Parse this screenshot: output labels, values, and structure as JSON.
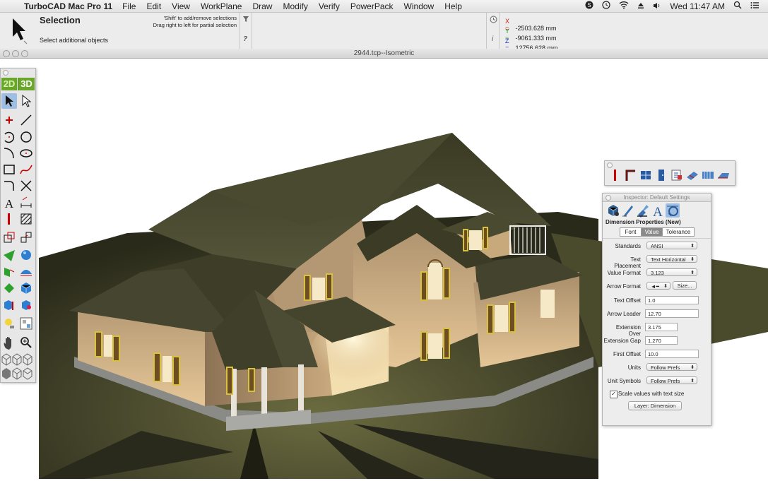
{
  "menubar": {
    "app_name": "TurboCAD Mac Pro 11",
    "items": [
      "File",
      "Edit",
      "View",
      "WorkPlane",
      "Draw",
      "Modify",
      "Verify",
      "PowerPack",
      "Window",
      "Help"
    ],
    "clock": "Wed 11:47 AM"
  },
  "selection_bar": {
    "title": "Selection",
    "hint_line1": "'Shift' to add/remove selections",
    "hint_line2": "Drag right to left for partial selection",
    "status": "Select additional objects",
    "help_symbol": "?",
    "info_symbol": "i"
  },
  "coordinates": {
    "x_label": "X =",
    "x_value": "-2503.628 mm",
    "y_label": "Y =",
    "y_value": "-9061.333 mm",
    "z_label": "Z =",
    "z_value": "12756.628 mm"
  },
  "document": {
    "title": "2944.tcp--Isometric"
  },
  "palette": {
    "mode_2d": "2D",
    "mode_3d": "3D"
  },
  "inspector": {
    "window_title": "Inspector: Default Settings",
    "section_title": "Dimension Properties (New)",
    "tabs": [
      "Font",
      "Value",
      "Tolerance"
    ],
    "active_tab": "Value",
    "fields": {
      "standards_label": "Standards",
      "standards_value": "ANSI",
      "text_placement_label": "Text Placement",
      "text_placement_value": "Text Horizontal",
      "value_format_label": "Value Format",
      "value_format_value": "3.123",
      "arrow_format_label": "Arrow Format",
      "arrow_format_value": "◄━",
      "size_button": "Size...",
      "text_offset_label": "Text Offset",
      "text_offset_value": "1.0",
      "arrow_leader_label": "Arrow Leader",
      "arrow_leader_value": "12.70",
      "extension_over_label": "Extension Over",
      "extension_over_value": "3.175",
      "extension_gap_label": "Extension Gap",
      "extension_gap_value": "1.270",
      "first_offset_label": "First Offset",
      "first_offset_value": "10.0",
      "units_label": "Units",
      "units_value": "Follow Prefs",
      "unit_symbols_label": "Unit Symbols",
      "unit_symbols_value": "Follow Prefs"
    },
    "scale_checkbox_label": "Scale values with text size",
    "scale_checked": true,
    "layer_button": "Layer: Dimension"
  },
  "colors": {
    "accent_green": "#6aa52c",
    "selected_tool": "#9ebfe2",
    "roof": "#4a4a30",
    "wall": "#d9b98c",
    "ground": "#3c3c22"
  }
}
